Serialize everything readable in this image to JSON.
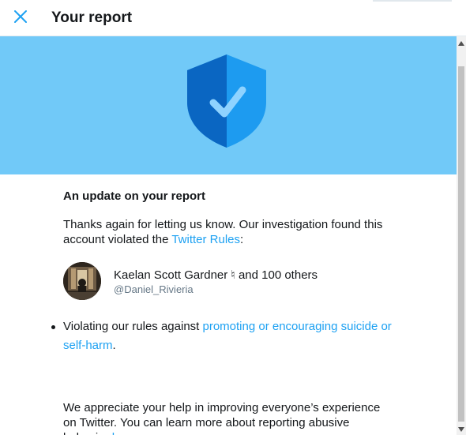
{
  "header": {
    "title": "Your report",
    "close_icon": "close-icon"
  },
  "hero": {
    "background_color": "#71c9f8",
    "icon": "shield-check-icon"
  },
  "report": {
    "heading": "An update on your report",
    "intro_text": "Thanks again for letting us know. Our investigation found this account violated the ",
    "rules_link": "Twitter Rules",
    "intro_end": ":"
  },
  "account": {
    "display_name": "Kaelan Scott Gardner ♮ and 100 others",
    "handle": "@Daniel_Rivieria"
  },
  "violation": {
    "prefix": "Violating our rules against ",
    "link": "promoting or encouraging suicide or self-harm",
    "suffix": "."
  },
  "closing": {
    "text": "We appreciate your help in improving everyone’s experience on Twitter. You can learn more about reporting abusive behavior ",
    "link": "here",
    "suffix": "."
  },
  "colors": {
    "accent": "#1da1f2",
    "text": "#14171a",
    "muted": "#657786"
  }
}
